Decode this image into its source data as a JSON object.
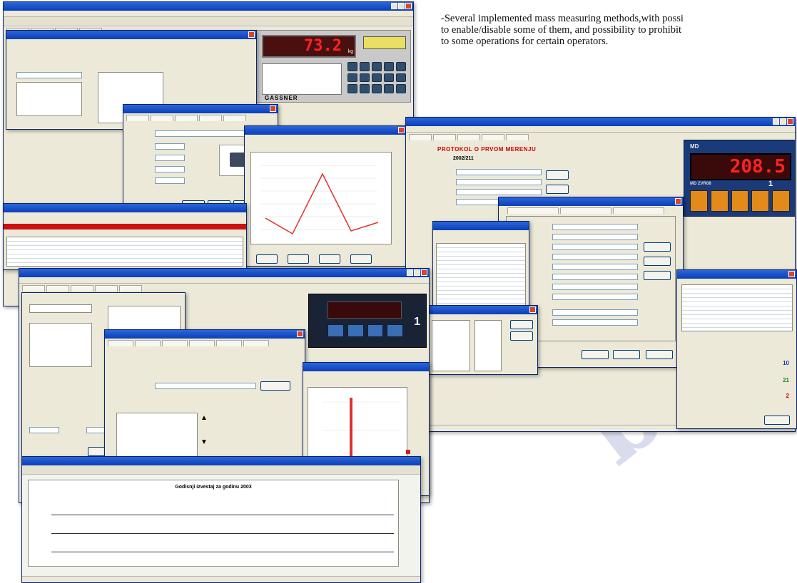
{
  "description_text": {
    "line1": "-Several implemented mass measuring methods,with possi",
    "line2": "to enable/disable some of them, and possibility to prohibit",
    "line3": "to some operations for certain operators."
  },
  "watermark": {
    "text": "ble",
    "color": "#d9dcec"
  },
  "gassner_display": {
    "reading": "73.2",
    "unit": "kg",
    "brand": "GASSNER"
  },
  "md_display": {
    "brand": "MD",
    "reading": "208.5",
    "model": "MD ZVR08",
    "index": "1"
  },
  "keypad_display": {
    "reading": "",
    "index": "1"
  },
  "protokol_window": {
    "heading": "PROTOKOL O PRVOM MERENJU",
    "number": "2002/211"
  },
  "report_window": {
    "heading": "Godisnji izvestaj za godinu 2003"
  },
  "summary_window": {
    "labels": [],
    "values": [
      "10",
      "21",
      "2"
    ]
  },
  "accent_colors": {
    "title_bar": "#0b3fb5",
    "alert_red": "#e01818",
    "display_red": "#ff2222",
    "display_blue": "#1b3a7a",
    "grid_green": "#2e9d2e"
  }
}
